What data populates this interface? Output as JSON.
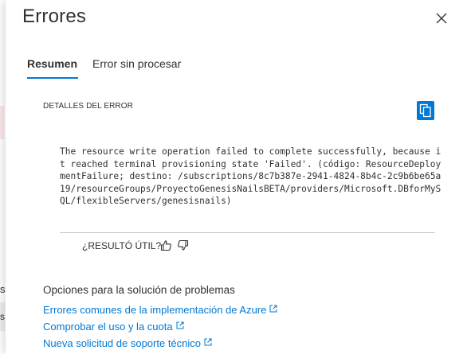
{
  "background": {
    "visible_fragment_1": "s",
    "visible_fragment_2": "s"
  },
  "panel": {
    "title": "Errores",
    "close_icon": "close-icon"
  },
  "tabs": [
    {
      "label": "Resumen",
      "active": true
    },
    {
      "label": "Error sin procesar",
      "active": false
    }
  ],
  "error_details": {
    "label": "DETALLES DEL ERROR",
    "copy_icon": "copy-icon",
    "message": "The resource write operation failed to complete successfully, because it reached terminal provisioning state 'Failed'. (código: ResourceDeploymentFailure; destino: /subscriptions/8c7b387e-2941-4824-8b4c-2c9b6be65a19/resourceGroups/ProyectoGenesisNailsBETA/providers/Microsoft.DBforMySQL/flexibleServers/genesisnails)"
  },
  "feedback": {
    "question": "¿RESULTÓ ÚTIL?",
    "thumbs_up_icon": "thumbs-up-icon",
    "thumbs_down_icon": "thumbs-down-icon"
  },
  "troubleshooting": {
    "title": "Opciones para la solución de problemas",
    "links": [
      {
        "label": "Errores comunes de la implementación de Azure"
      },
      {
        "label": "Comprobar el uso y la cuota"
      },
      {
        "label": "Nueva solicitud de soporte técnico"
      }
    ],
    "external_link_icon": "external-link-icon"
  },
  "colors": {
    "accent": "#0078d4",
    "text": "#323130",
    "divider": "#c8c6c4"
  }
}
